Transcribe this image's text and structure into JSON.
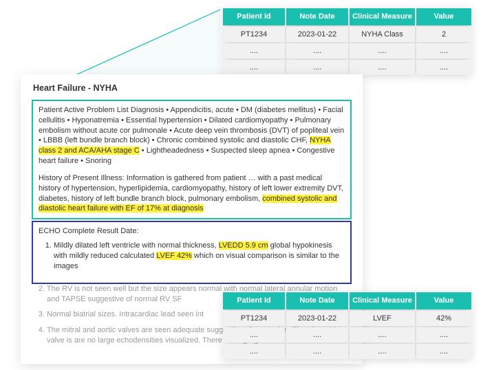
{
  "tables": {
    "top": {
      "headers": [
        "Patient Id",
        "Note Date",
        "Clinical Measure",
        "Value"
      ],
      "rows": [
        [
          "PT1234",
          "2023-01-22",
          "NYHA Class",
          "2"
        ],
        [
          "....",
          "....",
          "....",
          "...."
        ],
        [
          "....",
          "....",
          "....",
          "...."
        ]
      ]
    },
    "bottom": {
      "headers": [
        "Patient Id",
        "Note Date",
        "Clinical Measure",
        "Value"
      ],
      "rows": [
        [
          "PT1234",
          "2023-01-22",
          "LVEF",
          "42%"
        ],
        [
          "....",
          "....",
          "....",
          "...."
        ],
        [
          "....",
          "....",
          "....",
          "...."
        ]
      ]
    }
  },
  "document": {
    "title": "Heart Failure - NYHA",
    "problem_list_prefix": "Patient Active Problem List Diagnosis • Appendicitis, acute • DM (diabetes mellitus) • Facial cellulitis • Hyponatremia • Essential hypertension • Dilated cardiomyopathy • Pulmonary embolism without acute cor pulmonale • Acute deep vein thrombosis (DVT) of popliteal vein • LBBB (left bundle branch block) • Chronic combined systolic and diastolic CHF, ",
    "problem_highlight": "NYHA class 2 and ACA/AHA stage C",
    "problem_list_suffix": " • Lightheadedness • Suspected sleep apnea • Congestive heart failure • Snoring",
    "hpi_prefix": "History of Present Illness: Information is gathered from patient … with a past medical history of hypertension, hyperlipidemia, cardiomyopathy, history of left lower extremity DVT, diabetes, history of left bundle branch block, pulmonary embolism, ",
    "hpi_highlight": "combined systolic and diastolic heart failure with EF of 17% at diagnosis",
    "echo_header": "ECHO Complete Result Date:",
    "echo_item1_a": "Mildly dilated left ventricle with normal thickness, ",
    "echo_item1_hl1": "LVEDD 5.9 cm",
    "echo_item1_b": " global hypokinesis with mildly reduced calculated ",
    "echo_item1_hl2": "LVEF 42%",
    "echo_item1_c": " which on visual comparison is similar to the images",
    "echo_item2": "The RV is not seen well but the size appears normal with normal lateral annular motion and TAPSE suggestive of normal RV SF",
    "echo_item3": "Normal biatrial sizes. Intracardiac lead seen int",
    "echo_item4": "The mitral and aortic valves are seen adequate suggestive of vegetation. The tricuspid valve is are no large echodensities visualized. There is t regurgitations"
  }
}
